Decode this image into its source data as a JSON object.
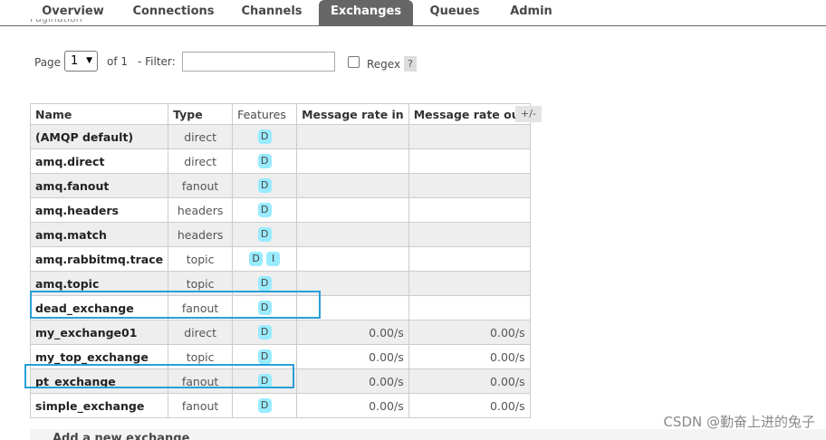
{
  "nav": {
    "tabs": [
      "Overview",
      "Connections",
      "Channels",
      "Exchanges",
      "Queues",
      "Admin"
    ],
    "active": "Exchanges"
  },
  "pagination": {
    "legend": "Pagination",
    "page_label": "Page",
    "page_value": "1",
    "of_label": "of 1",
    "filter_label": "- Filter:",
    "filter_value": "",
    "regex_label": "Regex",
    "regex_checked": false,
    "help": "?"
  },
  "table": {
    "headers": [
      "Name",
      "Type",
      "Features",
      "Message rate in",
      "Message rate out"
    ],
    "toggle": "+/-",
    "rows": [
      {
        "name": "(AMQP default)",
        "type": "direct",
        "features": [
          "D"
        ],
        "rate_in": "",
        "rate_out": ""
      },
      {
        "name": "amq.direct",
        "type": "direct",
        "features": [
          "D"
        ],
        "rate_in": "",
        "rate_out": ""
      },
      {
        "name": "amq.fanout",
        "type": "fanout",
        "features": [
          "D"
        ],
        "rate_in": "",
        "rate_out": ""
      },
      {
        "name": "amq.headers",
        "type": "headers",
        "features": [
          "D"
        ],
        "rate_in": "",
        "rate_out": ""
      },
      {
        "name": "amq.match",
        "type": "headers",
        "features": [
          "D"
        ],
        "rate_in": "",
        "rate_out": ""
      },
      {
        "name": "amq.rabbitmq.trace",
        "type": "topic",
        "features": [
          "D",
          "I"
        ],
        "rate_in": "",
        "rate_out": ""
      },
      {
        "name": "amq.topic",
        "type": "topic",
        "features": [
          "D"
        ],
        "rate_in": "",
        "rate_out": ""
      },
      {
        "name": "dead_exchange",
        "type": "fanout",
        "features": [
          "D"
        ],
        "rate_in": "",
        "rate_out": ""
      },
      {
        "name": "my_exchange01",
        "type": "direct",
        "features": [
          "D"
        ],
        "rate_in": "0.00/s",
        "rate_out": "0.00/s"
      },
      {
        "name": "my_top_exchange",
        "type": "topic",
        "features": [
          "D"
        ],
        "rate_in": "0.00/s",
        "rate_out": "0.00/s"
      },
      {
        "name": "pt_exchange",
        "type": "fanout",
        "features": [
          "D"
        ],
        "rate_in": "0.00/s",
        "rate_out": "0.00/s"
      },
      {
        "name": "simple_exchange",
        "type": "fanout",
        "features": [
          "D"
        ],
        "rate_in": "0.00/s",
        "rate_out": "0.00/s"
      }
    ]
  },
  "add_section": {
    "label": "Add a new exchange"
  },
  "watermark": "CSDN @勤奋上进的兔子",
  "colors": {
    "active_tab": "#666666",
    "feature_badge": "#99ebff",
    "highlight": "#2a9fd6"
  }
}
